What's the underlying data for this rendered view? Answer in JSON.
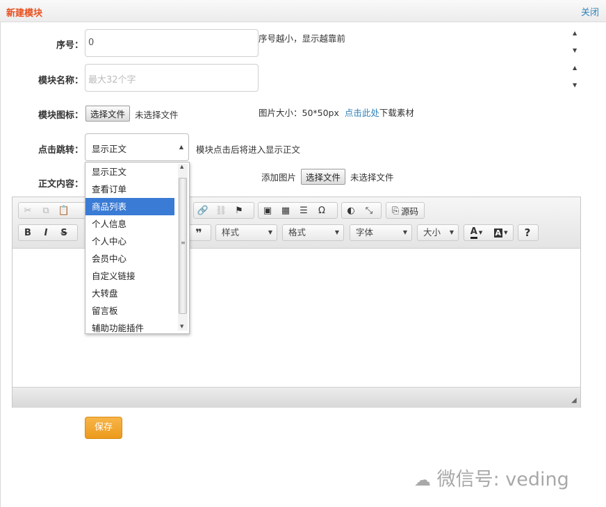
{
  "header": {
    "title": "新建模块",
    "close_label": "关闭"
  },
  "fields": {
    "order": {
      "label": "序号：",
      "value": "0",
      "hint": "序号越小，显示越靠前"
    },
    "name": {
      "label": "模块名称：",
      "placeholder": "最大32个字"
    },
    "icon": {
      "label": "模块图标：",
      "file_button": "选择文件",
      "file_status": "未选择文件",
      "size_hint": "图片大小：50*50px",
      "download_link": "点击此处",
      "download_suffix": "下载素材"
    },
    "jump": {
      "label": "点击跳转：",
      "selected": "显示正文",
      "hint": "模块点击后将进入显示正文",
      "options": [
        "显示正文",
        "查看订单",
        "商品列表",
        "个人信息",
        "个人中心",
        "会员中心",
        "自定义链接",
        "大转盘",
        "留言板",
        "辅助功能插件"
      ],
      "highlighted": "商品列表"
    },
    "content": {
      "label": "正文内容：",
      "add_image_label": "添加图片",
      "file_button": "选择文件",
      "file_status": "未选择文件"
    }
  },
  "editor": {
    "source_label": "源码",
    "combos": {
      "style": "样式",
      "format": "格式",
      "font": "字体",
      "size": "大小"
    }
  },
  "save_label": "保存",
  "watermark": "微信号: veding",
  "colors": {
    "title": "#e8501e",
    "link": "#2e7fb8",
    "save": "#f0a42a",
    "highlight": "#3a7bd5"
  }
}
